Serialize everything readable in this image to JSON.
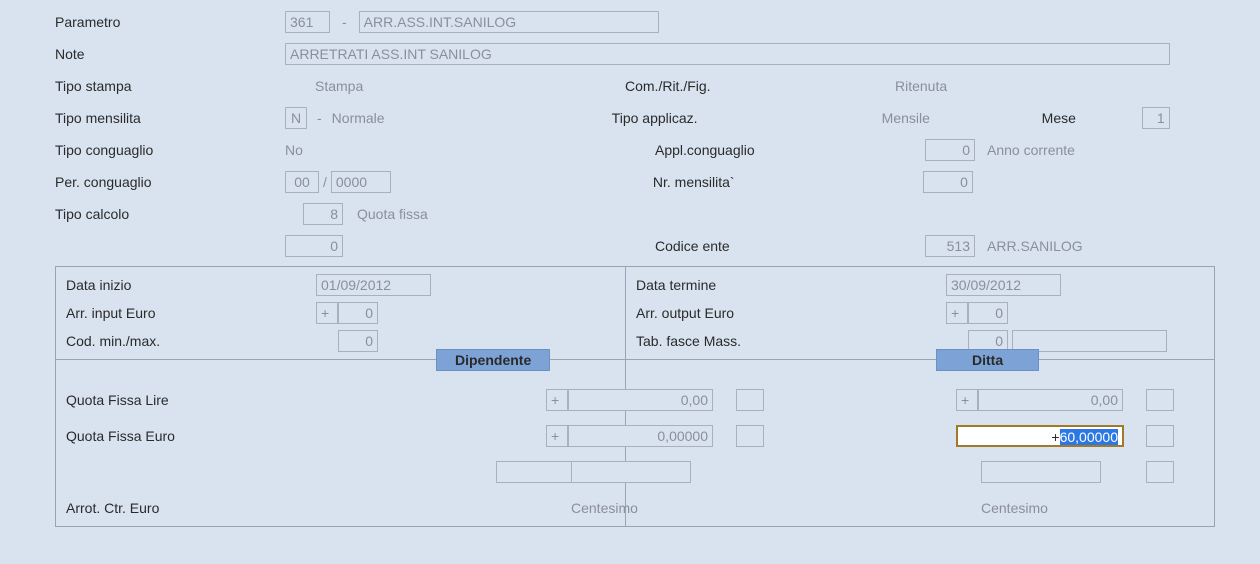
{
  "labels": {
    "parametro": "Parametro",
    "note": "Note",
    "tipo_stampa": "Tipo stampa",
    "com_rit_fig": "Com./Rit./Fig.",
    "tipo_mensilita": "Tipo mensilita",
    "tipo_applicaz": "Tipo applicaz.",
    "mese": "Mese",
    "tipo_conguaglio": "Tipo conguaglio",
    "appl_conguaglio": "Appl.conguaglio",
    "per_conguaglio": "Per. conguaglio",
    "nr_mensilita": "Nr. mensilita`",
    "tipo_calcolo": "Tipo calcolo",
    "codice_ente": "Codice ente",
    "data_inizio": "Data inizio",
    "data_termine": "Data termine",
    "arr_input_euro": "Arr. input Euro",
    "arr_output_euro": "Arr. output Euro",
    "cod_min_max": "Cod. min./max.",
    "tab_fasce_mass": "Tab. fasce Mass.",
    "dipendente": "Dipendente",
    "ditta": "Ditta",
    "quota_fissa_lire": "Quota Fissa Lire",
    "quota_fissa_euro": "Quota Fissa Euro",
    "arrot_ctr_euro": "Arrot. Ctr. Euro",
    "centesimo": "Centesimo",
    "anno_corrente": "Anno corrente",
    "dash": "-",
    "slash": "/",
    "plus": "+"
  },
  "values": {
    "parametro_code": "361",
    "parametro_desc": "ARR.ASS.INT.SANILOG",
    "note": "ARRETRATI ASS.INT SANILOG",
    "tipo_stampa": "Stampa",
    "com_rit_fig": "Ritenuta",
    "tipo_mensilita_code": "N",
    "tipo_mensilita_desc": "Normale",
    "tipo_applicaz": "Mensile",
    "mese": "1",
    "tipo_conguaglio": "No",
    "appl_conguaglio_val": "0",
    "per_conguaglio_mm": "00",
    "per_conguaglio_yyyy": "0000",
    "nr_mensilita": "0",
    "tipo_calcolo_code": "8",
    "tipo_calcolo_desc": "Quota fissa",
    "zero_box": "0",
    "codice_ente_code": "513",
    "codice_ente_desc": "ARR.SANILOG",
    "data_inizio": "01/09/2012",
    "data_termine": "30/09/2012",
    "arr_input_sign": "+",
    "arr_input_val": "0",
    "arr_output_sign": "+",
    "arr_output_val": "0",
    "cod_min_max": "0",
    "tab_fasce_mass": "0",
    "dip_lire_sign": "+",
    "dip_lire_val": "0,00",
    "dip_euro_sign": "+",
    "dip_euro_val": "0,00000",
    "ditta_lire_sign": "+",
    "ditta_lire_val": "0,00",
    "ditta_euro_sign": "+",
    "ditta_euro_val": "60,00000"
  }
}
